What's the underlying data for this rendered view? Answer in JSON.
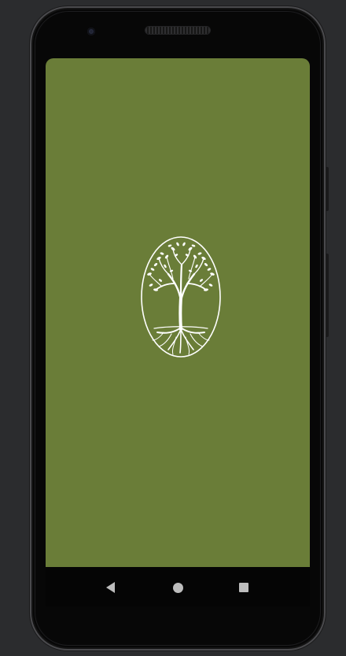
{
  "device": {
    "frame_color": "#070707",
    "background_color": "#2b2c2e"
  },
  "splash": {
    "background_color": "#6a7d38",
    "logo": {
      "icon": "tree-of-life-icon",
      "color": "#ffffff"
    }
  },
  "navigation_bar": {
    "buttons": [
      {
        "name": "back",
        "icon": "back-triangle-icon"
      },
      {
        "name": "home",
        "icon": "home-circle-icon"
      },
      {
        "name": "recents",
        "icon": "recents-square-icon"
      }
    ],
    "icon_color": "#bdbdbd"
  }
}
